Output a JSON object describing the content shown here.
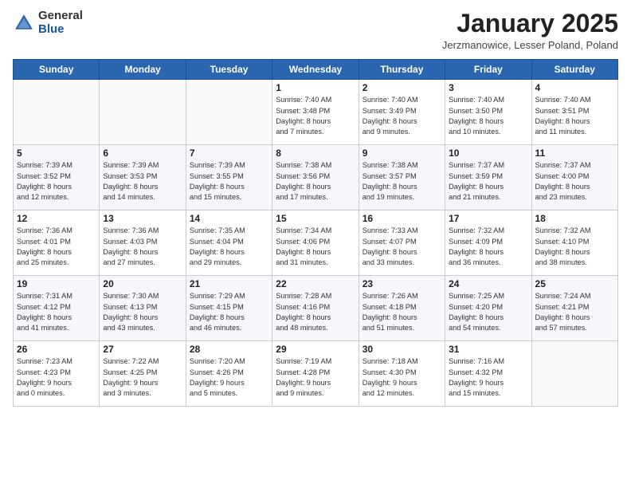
{
  "header": {
    "logo_general": "General",
    "logo_blue": "Blue",
    "month_title": "January 2025",
    "location": "Jerzmanowice, Lesser Poland, Poland"
  },
  "days_of_week": [
    "Sunday",
    "Monday",
    "Tuesday",
    "Wednesday",
    "Thursday",
    "Friday",
    "Saturday"
  ],
  "weeks": [
    [
      {
        "num": "",
        "info": ""
      },
      {
        "num": "",
        "info": ""
      },
      {
        "num": "",
        "info": ""
      },
      {
        "num": "1",
        "info": "Sunrise: 7:40 AM\nSunset: 3:48 PM\nDaylight: 8 hours\nand 7 minutes."
      },
      {
        "num": "2",
        "info": "Sunrise: 7:40 AM\nSunset: 3:49 PM\nDaylight: 8 hours\nand 9 minutes."
      },
      {
        "num": "3",
        "info": "Sunrise: 7:40 AM\nSunset: 3:50 PM\nDaylight: 8 hours\nand 10 minutes."
      },
      {
        "num": "4",
        "info": "Sunrise: 7:40 AM\nSunset: 3:51 PM\nDaylight: 8 hours\nand 11 minutes."
      }
    ],
    [
      {
        "num": "5",
        "info": "Sunrise: 7:39 AM\nSunset: 3:52 PM\nDaylight: 8 hours\nand 12 minutes."
      },
      {
        "num": "6",
        "info": "Sunrise: 7:39 AM\nSunset: 3:53 PM\nDaylight: 8 hours\nand 14 minutes."
      },
      {
        "num": "7",
        "info": "Sunrise: 7:39 AM\nSunset: 3:55 PM\nDaylight: 8 hours\nand 15 minutes."
      },
      {
        "num": "8",
        "info": "Sunrise: 7:38 AM\nSunset: 3:56 PM\nDaylight: 8 hours\nand 17 minutes."
      },
      {
        "num": "9",
        "info": "Sunrise: 7:38 AM\nSunset: 3:57 PM\nDaylight: 8 hours\nand 19 minutes."
      },
      {
        "num": "10",
        "info": "Sunrise: 7:37 AM\nSunset: 3:59 PM\nDaylight: 8 hours\nand 21 minutes."
      },
      {
        "num": "11",
        "info": "Sunrise: 7:37 AM\nSunset: 4:00 PM\nDaylight: 8 hours\nand 23 minutes."
      }
    ],
    [
      {
        "num": "12",
        "info": "Sunrise: 7:36 AM\nSunset: 4:01 PM\nDaylight: 8 hours\nand 25 minutes."
      },
      {
        "num": "13",
        "info": "Sunrise: 7:36 AM\nSunset: 4:03 PM\nDaylight: 8 hours\nand 27 minutes."
      },
      {
        "num": "14",
        "info": "Sunrise: 7:35 AM\nSunset: 4:04 PM\nDaylight: 8 hours\nand 29 minutes."
      },
      {
        "num": "15",
        "info": "Sunrise: 7:34 AM\nSunset: 4:06 PM\nDaylight: 8 hours\nand 31 minutes."
      },
      {
        "num": "16",
        "info": "Sunrise: 7:33 AM\nSunset: 4:07 PM\nDaylight: 8 hours\nand 33 minutes."
      },
      {
        "num": "17",
        "info": "Sunrise: 7:32 AM\nSunset: 4:09 PM\nDaylight: 8 hours\nand 36 minutes."
      },
      {
        "num": "18",
        "info": "Sunrise: 7:32 AM\nSunset: 4:10 PM\nDaylight: 8 hours\nand 38 minutes."
      }
    ],
    [
      {
        "num": "19",
        "info": "Sunrise: 7:31 AM\nSunset: 4:12 PM\nDaylight: 8 hours\nand 41 minutes."
      },
      {
        "num": "20",
        "info": "Sunrise: 7:30 AM\nSunset: 4:13 PM\nDaylight: 8 hours\nand 43 minutes."
      },
      {
        "num": "21",
        "info": "Sunrise: 7:29 AM\nSunset: 4:15 PM\nDaylight: 8 hours\nand 46 minutes."
      },
      {
        "num": "22",
        "info": "Sunrise: 7:28 AM\nSunset: 4:16 PM\nDaylight: 8 hours\nand 48 minutes."
      },
      {
        "num": "23",
        "info": "Sunrise: 7:26 AM\nSunset: 4:18 PM\nDaylight: 8 hours\nand 51 minutes."
      },
      {
        "num": "24",
        "info": "Sunrise: 7:25 AM\nSunset: 4:20 PM\nDaylight: 8 hours\nand 54 minutes."
      },
      {
        "num": "25",
        "info": "Sunrise: 7:24 AM\nSunset: 4:21 PM\nDaylight: 8 hours\nand 57 minutes."
      }
    ],
    [
      {
        "num": "26",
        "info": "Sunrise: 7:23 AM\nSunset: 4:23 PM\nDaylight: 9 hours\nand 0 minutes."
      },
      {
        "num": "27",
        "info": "Sunrise: 7:22 AM\nSunset: 4:25 PM\nDaylight: 9 hours\nand 3 minutes."
      },
      {
        "num": "28",
        "info": "Sunrise: 7:20 AM\nSunset: 4:26 PM\nDaylight: 9 hours\nand 5 minutes."
      },
      {
        "num": "29",
        "info": "Sunrise: 7:19 AM\nSunset: 4:28 PM\nDaylight: 9 hours\nand 9 minutes."
      },
      {
        "num": "30",
        "info": "Sunrise: 7:18 AM\nSunset: 4:30 PM\nDaylight: 9 hours\nand 12 minutes."
      },
      {
        "num": "31",
        "info": "Sunrise: 7:16 AM\nSunset: 4:32 PM\nDaylight: 9 hours\nand 15 minutes."
      },
      {
        "num": "",
        "info": ""
      }
    ]
  ]
}
